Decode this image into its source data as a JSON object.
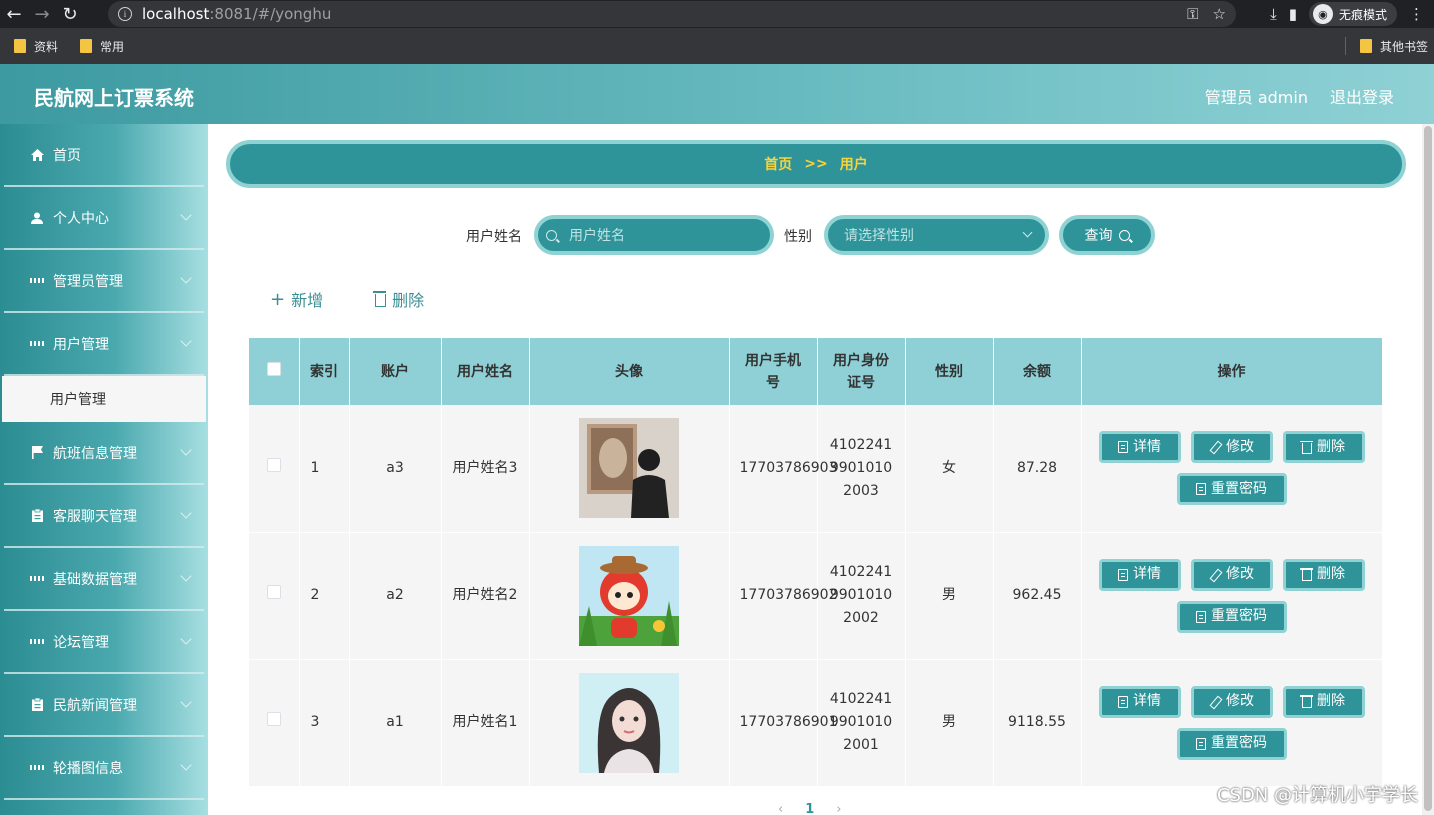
{
  "browser": {
    "url_host": "localhost",
    "url_rest": ":8081/#/yonghu",
    "incognito_label": "无痕模式",
    "bookmarks": [
      "资料",
      "常用"
    ],
    "bookmarks_right": "其他书签"
  },
  "header": {
    "title": "民航网上订票系统",
    "admin_label": "管理员 admin",
    "logout_label": "退出登录"
  },
  "sidebar": {
    "items": [
      {
        "label": "首页",
        "icon": "home-icon"
      },
      {
        "label": "个人中心",
        "icon": "user-icon"
      },
      {
        "label": "管理员管理",
        "icon": "grid-icon"
      },
      {
        "label": "用户管理",
        "icon": "grid-icon"
      },
      {
        "label": "航班信息管理",
        "icon": "flag-icon"
      },
      {
        "label": "客服聊天管理",
        "icon": "clipboard-icon"
      },
      {
        "label": "基础数据管理",
        "icon": "grid-icon"
      },
      {
        "label": "论坛管理",
        "icon": "grid-icon"
      },
      {
        "label": "民航新闻管理",
        "icon": "clipboard-icon"
      },
      {
        "label": "轮播图信息",
        "icon": "grid-icon"
      }
    ],
    "active_sub": "用户管理"
  },
  "breadcrumb": {
    "home": "首页",
    "sep": ">>",
    "current": "用户"
  },
  "search": {
    "name_label": "用户姓名",
    "name_placeholder": "用户姓名",
    "gender_label": "性别",
    "gender_placeholder": "请选择性别",
    "query_label": "查询"
  },
  "actions": {
    "add_label": "新增",
    "delete_label": "删除"
  },
  "table": {
    "headers": [
      "索引",
      "账户",
      "用户姓名",
      "头像",
      "用户手机号",
      "用户身份证号",
      "性别",
      "余额",
      "操作"
    ],
    "rows": [
      {
        "index": "1",
        "account": "a3",
        "name": "用户姓名3",
        "phone": "17703786903",
        "id_card": "410224199010102003",
        "gender": "女",
        "balance": "87.28"
      },
      {
        "index": "2",
        "account": "a2",
        "name": "用户姓名2",
        "phone": "17703786902",
        "id_card": "410224199010102002",
        "gender": "男",
        "balance": "962.45"
      },
      {
        "index": "3",
        "account": "a1",
        "name": "用户姓名1",
        "phone": "17703786901",
        "id_card": "410224199010102001",
        "gender": "男",
        "balance": "9118.55"
      }
    ],
    "ops": {
      "detail": "详情",
      "edit": "修改",
      "delete": "删除",
      "reset_pwd": "重置密码"
    }
  },
  "pager": {
    "prev": "‹",
    "current": "1",
    "next": "›"
  },
  "watermark": "CSDN @计算机小宇学长",
  "colors": {
    "primary": "#2f9499",
    "primary_border": "#8ed2d4",
    "breadcrumb_text": "#f8d33b",
    "table_header": "#8ed0d6"
  }
}
